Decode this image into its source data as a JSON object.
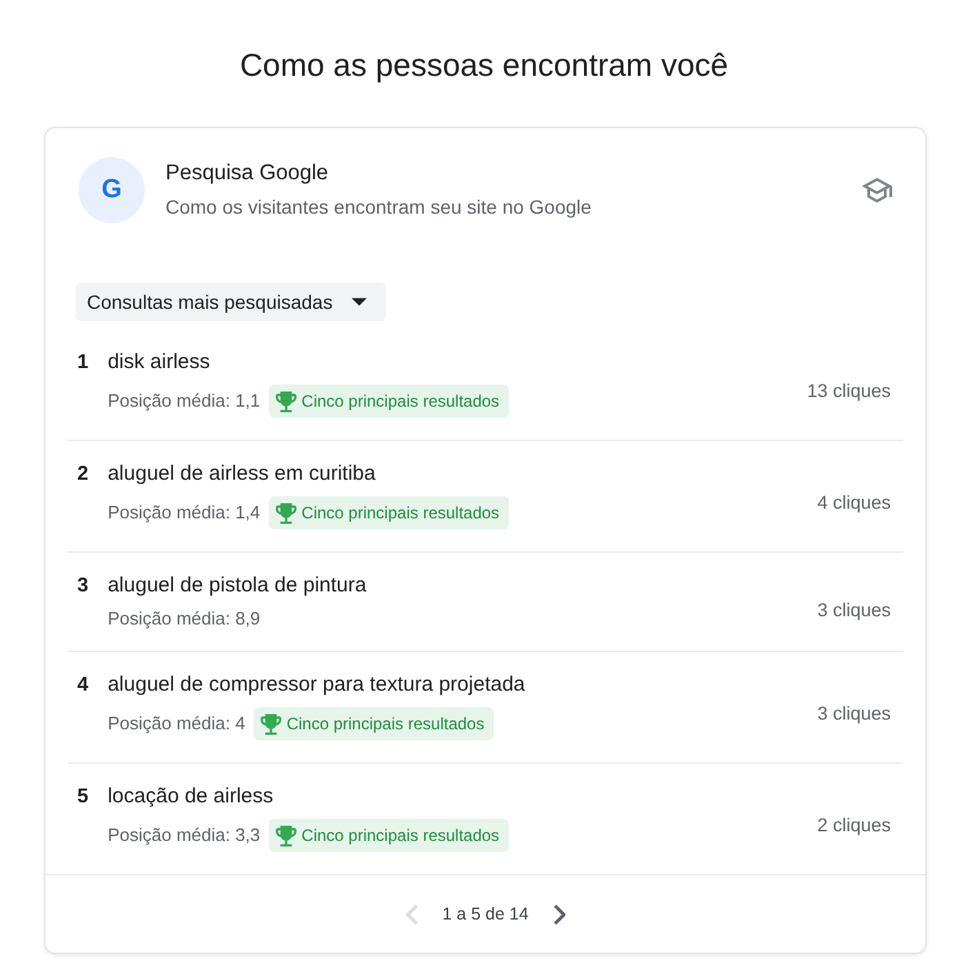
{
  "page_title": "Como as pessoas encontram você",
  "card": {
    "logo_letter": "G",
    "title": "Pesquisa Google",
    "subtitle": "Como os visitantes encontram seu site no Google"
  },
  "dropdown": {
    "label": "Consultas mais pesquisadas"
  },
  "queries": [
    {
      "rank": "1",
      "query": "disk airless",
      "position": "Posição média: 1,1",
      "badge": "Cinco principais resultados",
      "clicks": "13 cliques"
    },
    {
      "rank": "2",
      "query": "aluguel de airless em curitiba",
      "position": "Posição média: 1,4",
      "badge": "Cinco principais resultados",
      "clicks": "4 cliques"
    },
    {
      "rank": "3",
      "query": "aluguel de pistola de pintura",
      "position": "Posição média: 8,9",
      "clicks": "3 cliques"
    },
    {
      "rank": "4",
      "query": "aluguel de compressor para textura projetada",
      "position": "Posição média: 4",
      "badge": "Cinco principais resultados",
      "clicks": "3 cliques"
    },
    {
      "rank": "5",
      "query": "locação de airless",
      "position": "Posição média: 3,3",
      "badge": "Cinco principais resultados",
      "clicks": "2 cliques"
    }
  ],
  "pagination": {
    "previous": {
      "disabled": true
    },
    "label": "1 a 5 de 14",
    "next": {
      "disabled": false
    }
  }
}
